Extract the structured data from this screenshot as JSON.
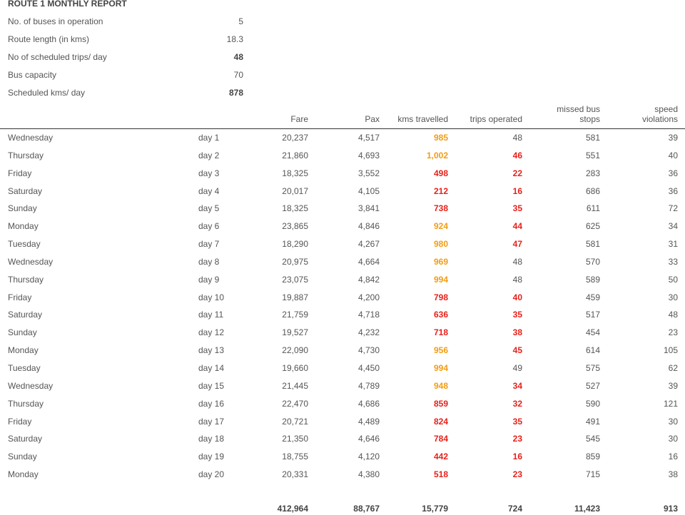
{
  "report": {
    "title": "ROUTE 1 MONTHLY REPORT",
    "summary": [
      {
        "label": "No. of buses in operation",
        "value": "5",
        "bold": false
      },
      {
        "label": "Route length (in kms)",
        "value": "18.3",
        "bold": false
      },
      {
        "label": "No of scheduled trips/ day",
        "value": "48",
        "bold": true
      },
      {
        "label": "Bus capacity",
        "value": "70",
        "bold": false
      },
      {
        "label": "Scheduled kms/ day",
        "value": "878",
        "bold": true
      }
    ]
  },
  "table": {
    "headers": {
      "fare": "Fare",
      "pax": "Pax",
      "kms": "kms travelled",
      "trips": "trips operated",
      "missed_1": "missed bus",
      "missed_2": "stops",
      "speed_1": "speed",
      "speed_2": "violations"
    },
    "rows": [
      {
        "day": "Wednesday",
        "dn": "day 1",
        "fare": "20,237",
        "pax": "4,517",
        "kms": "985",
        "kms_status": "orange",
        "trips": "48",
        "trips_status": "normal",
        "missed": "581",
        "speed": "39"
      },
      {
        "day": "Thursday",
        "dn": "day 2",
        "fare": "21,860",
        "pax": "4,693",
        "kms": "1,002",
        "kms_status": "orange",
        "trips": "46",
        "trips_status": "red",
        "missed": "551",
        "speed": "40"
      },
      {
        "day": "Friday",
        "dn": "day 3",
        "fare": "18,325",
        "pax": "3,552",
        "kms": "498",
        "kms_status": "red",
        "trips": "22",
        "trips_status": "red",
        "missed": "283",
        "speed": "36"
      },
      {
        "day": "Saturday",
        "dn": "day 4",
        "fare": "20,017",
        "pax": "4,105",
        "kms": "212",
        "kms_status": "red",
        "trips": "16",
        "trips_status": "red",
        "missed": "686",
        "speed": "36"
      },
      {
        "day": "Sunday",
        "dn": "day 5",
        "fare": "18,325",
        "pax": "3,841",
        "kms": "738",
        "kms_status": "red",
        "trips": "35",
        "trips_status": "red",
        "missed": "611",
        "speed": "72"
      },
      {
        "day": "Monday",
        "dn": "day 6",
        "fare": "23,865",
        "pax": "4,846",
        "kms": "924",
        "kms_status": "orange",
        "trips": "44",
        "trips_status": "red",
        "missed": "625",
        "speed": "34"
      },
      {
        "day": "Tuesday",
        "dn": "day 7",
        "fare": "18,290",
        "pax": "4,267",
        "kms": "980",
        "kms_status": "orange",
        "trips": "47",
        "trips_status": "red",
        "missed": "581",
        "speed": "31"
      },
      {
        "day": "Wednesday",
        "dn": "day 8",
        "fare": "20,975",
        "pax": "4,664",
        "kms": "969",
        "kms_status": "orange",
        "trips": "48",
        "trips_status": "normal",
        "missed": "570",
        "speed": "33"
      },
      {
        "day": "Thursday",
        "dn": "day 9",
        "fare": "23,075",
        "pax": "4,842",
        "kms": "994",
        "kms_status": "orange",
        "trips": "48",
        "trips_status": "normal",
        "missed": "589",
        "speed": "50"
      },
      {
        "day": "Friday",
        "dn": "day 10",
        "fare": "19,887",
        "pax": "4,200",
        "kms": "798",
        "kms_status": "red",
        "trips": "40",
        "trips_status": "red",
        "missed": "459",
        "speed": "30"
      },
      {
        "day": "Saturday",
        "dn": "day 11",
        "fare": "21,759",
        "pax": "4,718",
        "kms": "636",
        "kms_status": "red",
        "trips": "35",
        "trips_status": "red",
        "missed": "517",
        "speed": "48"
      },
      {
        "day": "Sunday",
        "dn": "day 12",
        "fare": "19,527",
        "pax": "4,232",
        "kms": "718",
        "kms_status": "red",
        "trips": "38",
        "trips_status": "red",
        "missed": "454",
        "speed": "23"
      },
      {
        "day": "Monday",
        "dn": "day 13",
        "fare": "22,090",
        "pax": "4,730",
        "kms": "956",
        "kms_status": "orange",
        "trips": "45",
        "trips_status": "red",
        "missed": "614",
        "speed": "105"
      },
      {
        "day": "Tuesday",
        "dn": "day 14",
        "fare": "19,660",
        "pax": "4,450",
        "kms": "994",
        "kms_status": "orange",
        "trips": "49",
        "trips_status": "normal",
        "missed": "575",
        "speed": "62"
      },
      {
        "day": "Wednesday",
        "dn": "day 15",
        "fare": "21,445",
        "pax": "4,789",
        "kms": "948",
        "kms_status": "orange",
        "trips": "34",
        "trips_status": "red",
        "missed": "527",
        "speed": "39"
      },
      {
        "day": "Thursday",
        "dn": "day 16",
        "fare": "22,470",
        "pax": "4,686",
        "kms": "859",
        "kms_status": "red",
        "trips": "32",
        "trips_status": "red",
        "missed": "590",
        "speed": "121"
      },
      {
        "day": "Friday",
        "dn": "day 17",
        "fare": "20,721",
        "pax": "4,489",
        "kms": "824",
        "kms_status": "red",
        "trips": "35",
        "trips_status": "red",
        "missed": "491",
        "speed": "30"
      },
      {
        "day": "Saturday",
        "dn": "day 18",
        "fare": "21,350",
        "pax": "4,646",
        "kms": "784",
        "kms_status": "red",
        "trips": "23",
        "trips_status": "red",
        "missed": "545",
        "speed": "30"
      },
      {
        "day": "Sunday",
        "dn": "day 19",
        "fare": "18,755",
        "pax": "4,120",
        "kms": "442",
        "kms_status": "red",
        "trips": "16",
        "trips_status": "red",
        "missed": "859",
        "speed": "16"
      },
      {
        "day": "Monday",
        "dn": "day 20",
        "fare": "20,331",
        "pax": "4,380",
        "kms": "518",
        "kms_status": "red",
        "trips": "23",
        "trips_status": "red",
        "missed": "715",
        "speed": "38"
      }
    ],
    "totals": {
      "fare": "412,964",
      "pax": "88,767",
      "kms": "15,779",
      "trips": "724",
      "missed": "11,423",
      "speed": "913"
    }
  },
  "colors": {
    "orange": "#f39c12",
    "red": "#e8201a",
    "normal": "#555555"
  }
}
